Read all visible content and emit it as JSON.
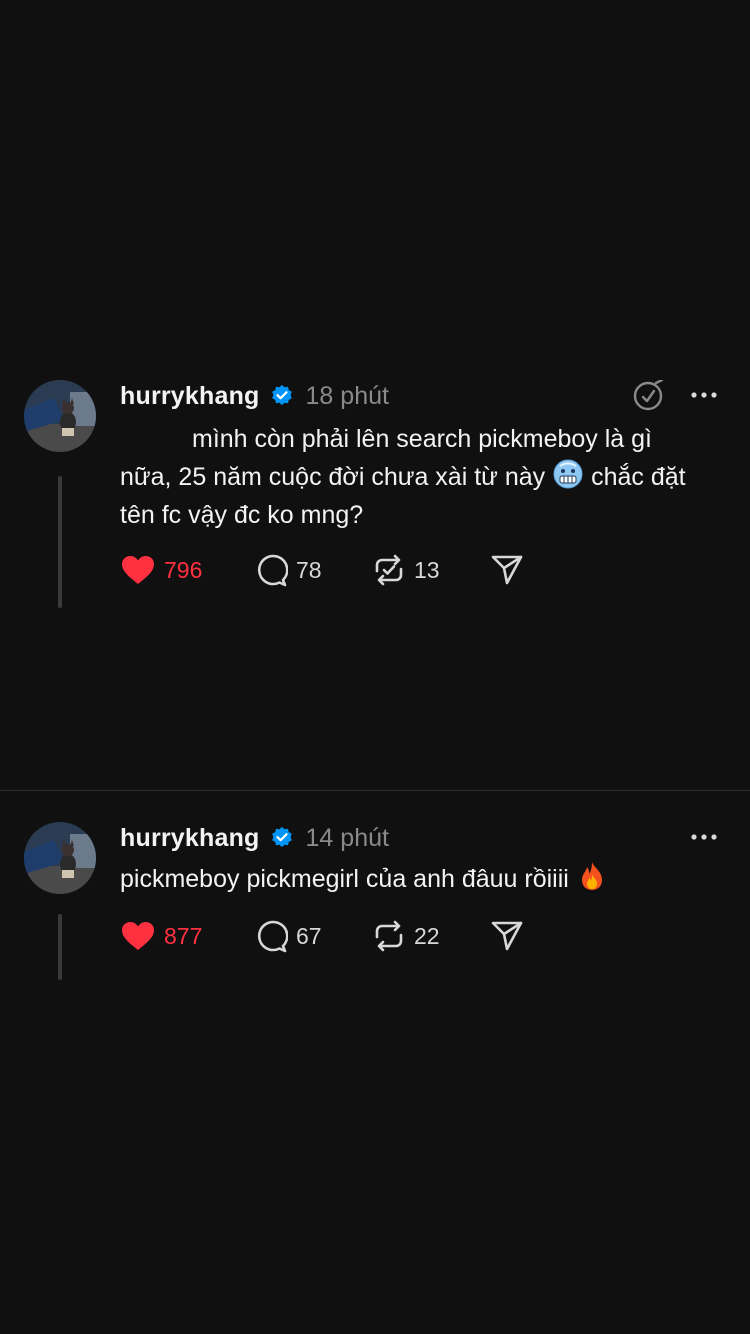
{
  "posts": [
    {
      "username": "hurrykhang",
      "time": "18 phút",
      "text_part1": "mình còn phải lên search pickmeboy là gì nữa, 25 năm cuộc đời chưa xài từ này",
      "text_part2": "chắc đặt tên fc vậy đc ko mng?",
      "emoji": "cold-face-emoji",
      "likes": "796",
      "replies": "78",
      "reposts": "13",
      "liked": true,
      "header_icons": [
        "mute-icon",
        "more-icon"
      ]
    },
    {
      "username": "hurrykhang",
      "time": "14 phút",
      "text_part1": "pickmeboy pickmegirl của anh đâuu rồiiii",
      "emoji": "fire-emoji",
      "likes": "877",
      "replies": "67",
      "reposts": "22",
      "liked": true,
      "header_icons": [
        "more-icon"
      ]
    }
  ],
  "colors": {
    "background": "#101010",
    "text": "#f3f3f3",
    "muted": "#8a8a8a",
    "like_red": "#ff3040",
    "verified_blue": "#0095f6"
  }
}
